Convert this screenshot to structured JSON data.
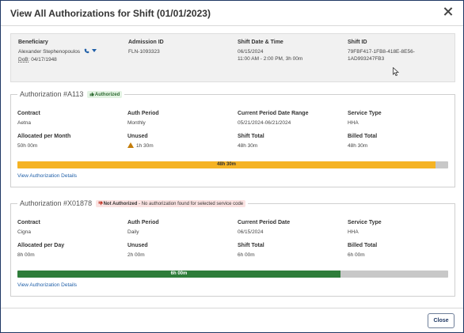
{
  "modal": {
    "title": "View All Authorizations for Shift (01/01/2023)",
    "close_icon": "close-icon"
  },
  "summary": {
    "beneficiary_label": "Beneficiary",
    "beneficiary_name": "Alexander Stephenopoulos",
    "dob_label": "DoB:",
    "dob_value": "04/17/1948",
    "admission_label": "Admission ID",
    "admission_value": "FLN-1093323",
    "shift_dt_label": "Shift Date & Time",
    "shift_date": "06/15/2024",
    "shift_time": "11:00 AM - 2:00 PM, 3h 00m",
    "shift_id_label": "Shift ID",
    "shift_id_line1": "79FBF417-1FB8-418E-8E56-",
    "shift_id_line2": "1AD993247FB3"
  },
  "auth1": {
    "title": "Authorization #A113",
    "badge": "Authorized",
    "contract_label": "Contract",
    "contract_value": "Aetna",
    "auth_period_label": "Auth Period",
    "auth_period_value": "Monthly",
    "range_label": "Current Period Date Range",
    "range_value": "05/21/2024-06/21/2024",
    "service_label": "Service Type",
    "service_value": "HHA",
    "allocated_label": "Allocated per Month",
    "allocated_value": "50h 00m",
    "unused_label": "Unused",
    "unused_value": "1h 30m",
    "shift_total_label": "Shift Total",
    "shift_total_value": "48h 30m",
    "billed_label": "Billed Total",
    "billed_value": "48h 30m",
    "bar_label": "48h 30m",
    "bar_fraction": 0.97,
    "bar_color": "#f5b324",
    "link": "View Authorization Details"
  },
  "auth2": {
    "title": "Authorization #X01878",
    "badge": "Not Authorized",
    "badge_extra": " - No authorization found for selected service code",
    "contract_label": "Contract",
    "contract_value": "Cigna",
    "auth_period_label": "Auth Period",
    "auth_period_value": "Daily",
    "date_label": "Current Period Date",
    "date_value": "06/15/2024",
    "service_label": "Service Type",
    "service_value": "HHA",
    "allocated_label": "Allocated per Day",
    "allocated_value": "8h 00m",
    "unused_label": "Unused",
    "unused_value": "2h 00m",
    "shift_total_label": "Shift Total",
    "shift_total_value": "6h 00m",
    "billed_label": "Billed Total",
    "billed_value": "6h 00m",
    "bar_label": "6h 00m",
    "bar_fraction": 0.75,
    "bar_color": "#2e7d3a",
    "link": "View Authorization Details"
  },
  "footer": {
    "close_label": "Close"
  }
}
